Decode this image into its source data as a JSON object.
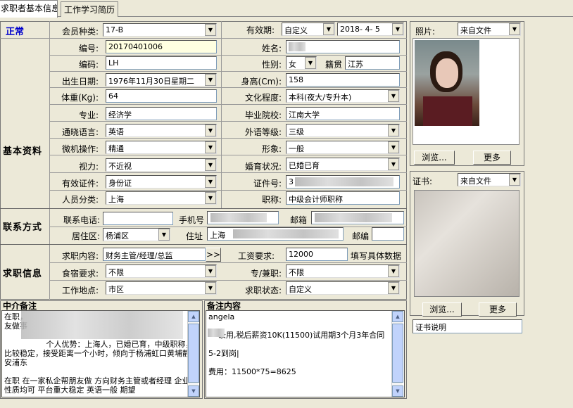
{
  "tabs": [
    {
      "label": "求职者基本信息"
    },
    {
      "label": "工作学习简历"
    }
  ],
  "status_text": "正常",
  "sections": {
    "basic": "基本资料",
    "contact": "联系方式",
    "job": "求职信息"
  },
  "basic": {
    "member_type_label": "会员种类:",
    "member_type_value": "17-B",
    "validity_label": "有效期:",
    "validity_value": "自定义",
    "validity_date": "2018- 4- 5",
    "number_label": "编号:",
    "number_value": "20170401006",
    "name_label": "姓名:",
    "code_label": "编码:",
    "code_value": "LH",
    "gender_label": "性别:",
    "gender_value": "女",
    "native_label": "籍贯",
    "native_value": "江苏",
    "birth_label": "出生日期:",
    "birth_value": "1976年11月30日星期二",
    "height_label": "身高(Cm):",
    "height_value": "158",
    "weight_label": "体重(Kg):",
    "weight_value": "64",
    "education_label": "文化程度:",
    "education_value": "本科(夜大/专升本)",
    "major_label": "专业:",
    "major_value": "经济学",
    "school_label": "毕业院校:",
    "school_value": "江南大学",
    "language_label": "通晓语言:",
    "language_value": "英语",
    "foreign_level_label": "外语等级:",
    "foreign_level_value": "三级",
    "computer_label": "微机操作:",
    "computer_value": "精通",
    "appearance_label": "形象:",
    "appearance_value": "一般",
    "vision_label": "视力:",
    "vision_value": "不近视",
    "marital_label": "婚育状况:",
    "marital_value": "已婚已育",
    "id_type_label": "有效证件:",
    "id_type_value": "身份证",
    "id_no_label": "证件号:",
    "id_no_value": "3",
    "category_label": "人员分类:",
    "category_value": "上海",
    "title_label": "职称:",
    "title_value": "中级会计师职称"
  },
  "contact": {
    "phone_label": "联系电话:",
    "mobile_label": "手机号",
    "email_label": "邮箱",
    "district_label": "居住区:",
    "district_value": "杨浦区",
    "address_label": "住址",
    "address_value": "上海",
    "zip_label": "邮编"
  },
  "job": {
    "position_label": "求职内容:",
    "position_value": "财务主管/经理/总监",
    "more_btn": ">>",
    "salary_label": "工资要求:",
    "salary_value": "12000",
    "salary_hint": "填写具体数据",
    "board_label": "食宿要求:",
    "board_value": "不限",
    "parttime_label": "专/兼职:",
    "parttime_value": "不限",
    "location_label": "工作地点:",
    "location_value": "市区",
    "status_label": "求职状态:",
    "status_value": "自定义"
  },
  "notes": {
    "agent_title": "中介备注",
    "agent_text": "在职，\n友做事\n\n                 个人优势：上海人，已婚已育，中级职称，比较稳定，接受距离一个小时，倾向于杨浦虹口黄埔静安浦东\n\n在职 在一家私企帮朋友做 方向财务主管或者经理 企业性质均可 平台重大稳定 英语一般 期望",
    "remark_title": "备注内容",
    "remark_text": "angela\n\n    录用,税后薪资10K(11500)试用期3个月3年合同\n\n5-2到岗|\n\n费用：11500*75=8625"
  },
  "photo": {
    "label": "照片:",
    "source_value": "来自文件",
    "browse_btn": "浏览...",
    "more_btn": "更多"
  },
  "cert": {
    "label": "证书:",
    "source_value": "来自文件",
    "browse_btn": "浏览...",
    "more_btn": "更多",
    "desc_label": "证书说明"
  }
}
